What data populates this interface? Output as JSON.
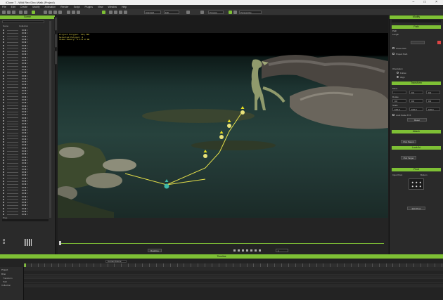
{
  "window": {
    "title": "iClone 7 - Wild Rex Dino Walk (Project)",
    "controls": [
      "–",
      "□",
      "×"
    ]
  },
  "menubar": {
    "items": [
      "File",
      "Edit",
      "Create",
      "Modify",
      "Animation",
      "Render",
      "Script",
      "Plugins",
      "View",
      "Window",
      "Help"
    ]
  },
  "toolbar": {
    "dropdowns": [
      "Standard",
      "Edit",
      "Preview",
      "Perspective"
    ]
  },
  "left_panel": {
    "title": "Scene",
    "header_cols": [
      "Name",
      "Collection"
    ],
    "bottom_label": "Prop"
  },
  "viewport": {
    "info_lines": [
      "Project Polygon: 143,796",
      "Selected Polygon: 0",
      "Video Memory: 2.1/2.0 GB"
    ],
    "side_tabs": [
      "Camera",
      "Edit",
      "Shortcut"
    ]
  },
  "right_panel": {
    "title": "Modify",
    "sections": [
      "Path",
      "Transform",
      "Attach",
      "Look At",
      "Pivot"
    ],
    "path_labels": [
      "Path",
      "Length",
      "Close Path",
      "Project Path",
      "Hide Gizmo",
      "Orientation"
    ],
    "follow_options": [
      "Follow",
      "Align"
    ],
    "transform_labels": [
      "Move",
      "Rotate",
      "Scale",
      "Lock Scale XYZ"
    ],
    "move": [
      "-",
      "0.0",
      "0.0"
    ],
    "rotate": [
      "0.0",
      "0.0",
      "0.0"
    ],
    "scale": [
      "100.0",
      "100.0",
      "100.0"
    ],
    "buttons": [
      "Reset",
      "Pick Parent",
      "Pick Target",
      "Edit Pivot"
    ],
    "pivot_label": "Input Pivot",
    "pivot_value": "Bottom"
  },
  "playbar": {
    "label": "Realtime",
    "frame": "1"
  },
  "timeline": {
    "title": "Timeline",
    "mode": "Current Frame",
    "tracks": [
      "Project",
      "Dino",
      "Transform",
      "Path",
      "Collection"
    ],
    "ruler_start": 1,
    "ruler_end": 600
  },
  "colors": {
    "accent": "#7ec035",
    "path_line": "#e6e04a",
    "node_color": "#e8e27a",
    "start_node": "#3fb8a7"
  }
}
